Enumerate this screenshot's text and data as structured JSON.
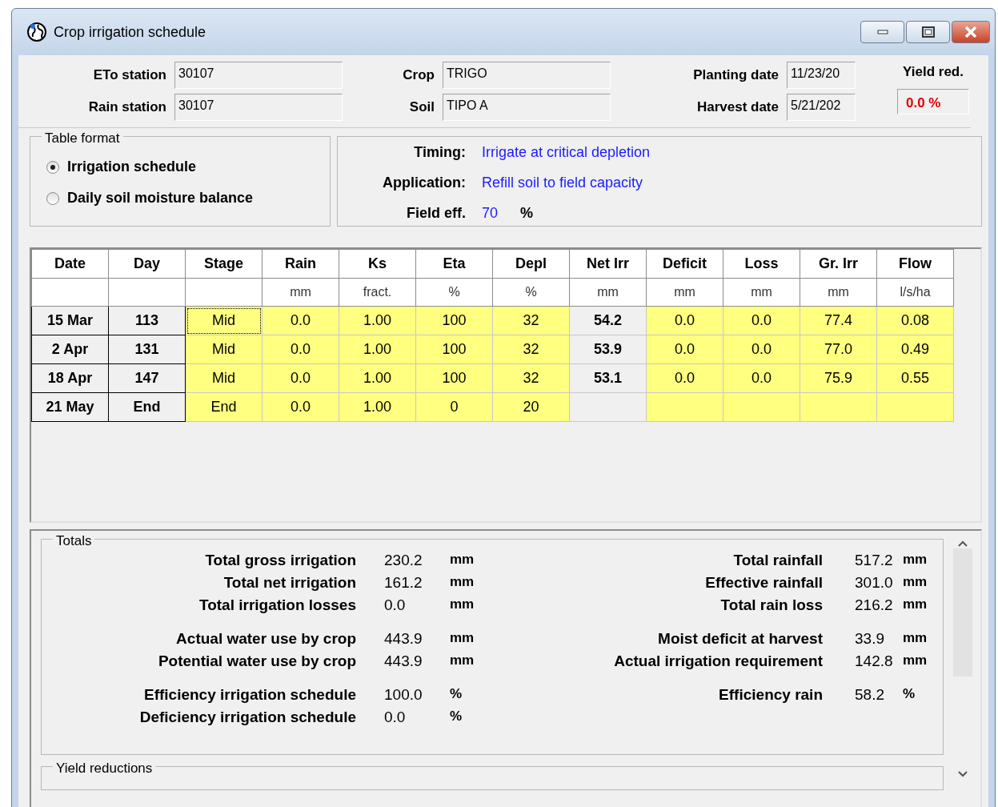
{
  "window": {
    "title": "Crop irrigation schedule"
  },
  "header": {
    "fields": [
      {
        "label": "ETo station",
        "value": "30107"
      },
      {
        "label": "Crop",
        "value": "TRIGO"
      },
      {
        "label": "Planting date",
        "value": "11/23/20"
      },
      {
        "label": "Rain station",
        "value": "30107"
      },
      {
        "label": "Soil",
        "value": "TIPO A"
      },
      {
        "label": "Harvest date",
        "value": "5/21/202"
      }
    ],
    "yield_reduction": {
      "label": "Yield red.",
      "value": "0.0 %"
    }
  },
  "table_format": {
    "title": "Table format",
    "options": [
      {
        "label": "Irrigation schedule",
        "selected": true
      },
      {
        "label": "Daily soil moisture balance",
        "selected": false
      }
    ]
  },
  "settings": [
    {
      "label": "Timing:",
      "value": "Irrigate at critical depletion"
    },
    {
      "label": "Application:",
      "value": "Refill soil to field capacity"
    },
    {
      "label": "Field eff.",
      "value": "70",
      "unit": "%"
    }
  ],
  "table": {
    "columns": [
      {
        "name": "Date"
      },
      {
        "name": "Day"
      },
      {
        "name": "Stage"
      },
      {
        "name": "Rain",
        "unit": "mm"
      },
      {
        "name": "Ks",
        "unit": "fract."
      },
      {
        "name": "Eta",
        "unit": "%"
      },
      {
        "name": "Depl",
        "unit": "%"
      },
      {
        "name": "Net Irr",
        "unit": "mm"
      },
      {
        "name": "Deficit",
        "unit": "mm"
      },
      {
        "name": "Loss",
        "unit": "mm"
      },
      {
        "name": "Gr. Irr",
        "unit": "mm"
      },
      {
        "name": "Flow",
        "unit": "l/s/ha"
      }
    ],
    "rows": [
      {
        "focused": true,
        "cells": [
          "15 Mar",
          "113",
          "Mid",
          "0.0",
          "1.00",
          "100",
          "32",
          "54.2",
          "0.0",
          "0.0",
          "77.4",
          "0.08"
        ]
      },
      {
        "focused": false,
        "cells": [
          "2 Apr",
          "131",
          "Mid",
          "0.0",
          "1.00",
          "100",
          "32",
          "53.9",
          "0.0",
          "0.0",
          "77.0",
          "0.49"
        ]
      },
      {
        "focused": false,
        "cells": [
          "18 Apr",
          "147",
          "Mid",
          "0.0",
          "1.00",
          "100",
          "32",
          "53.1",
          "0.0",
          "0.0",
          "75.9",
          "0.55"
        ]
      },
      {
        "focused": false,
        "cells": [
          "21 May",
          "End",
          "End",
          "0.0",
          "1.00",
          "0",
          "20",
          null,
          null,
          null,
          null,
          null
        ]
      }
    ]
  },
  "totals": {
    "title": "Totals",
    "groups": [
      {
        "left": [
          {
            "label": "Total gross irrigation",
            "value": "230.2",
            "unit": "mm"
          },
          {
            "label": "Total net irrigation",
            "value": "161.2",
            "unit": "mm"
          },
          {
            "label": "Total irrigation losses",
            "value": "0.0",
            "unit": "mm"
          }
        ],
        "right": [
          {
            "label": "Total rainfall",
            "value": "517.2",
            "unit": "mm"
          },
          {
            "label": "Effective rainfall",
            "value": "301.0",
            "unit": "mm"
          },
          {
            "label": "Total rain loss",
            "value": "216.2",
            "unit": "mm"
          }
        ]
      },
      {
        "left": [
          {
            "label": "Actual water use by crop",
            "value": "443.9",
            "unit": "mm"
          },
          {
            "label": "Potential water use by crop",
            "value": "443.9",
            "unit": "mm"
          }
        ],
        "right": [
          {
            "label": "Moist deficit at harvest",
            "value": "33.9",
            "unit": "mm"
          },
          {
            "label": "Actual irrigation requirement",
            "value": "142.8",
            "unit": "mm"
          }
        ]
      },
      {
        "left": [
          {
            "label": "Efficiency irrigation schedule",
            "value": "100.0",
            "unit": "%"
          },
          {
            "label": "Deficiency irrigation schedule",
            "value": "0.0",
            "unit": "%"
          }
        ],
        "right": [
          {
            "label": "Efficiency rain",
            "value": "58.2",
            "unit": "%"
          }
        ]
      }
    ]
  },
  "yield_reductions": {
    "title": "Yield reductions"
  }
}
